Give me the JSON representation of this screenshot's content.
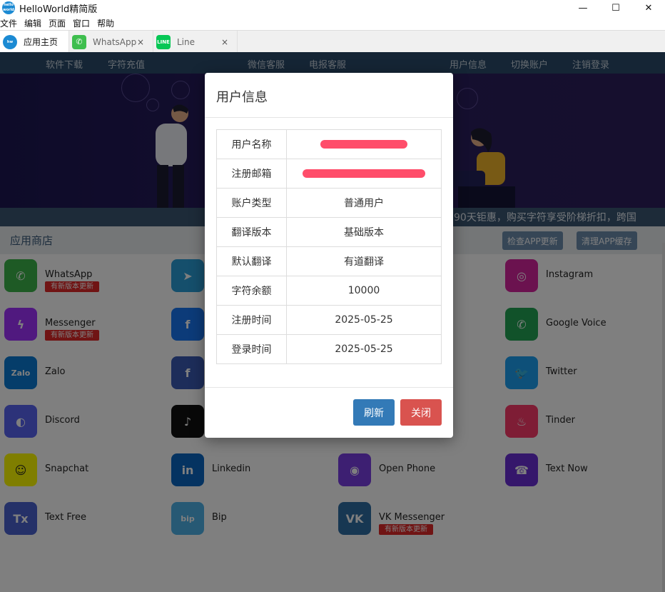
{
  "window": {
    "title": "HelloWorld精简版",
    "logo_text": "hello world",
    "minimize": "—",
    "maximize": "☐",
    "close": "✕"
  },
  "menu": [
    "文件",
    "编辑",
    "页面",
    "窗口",
    "帮助"
  ],
  "tabs": [
    {
      "label": "应用主页",
      "active": true,
      "icon": "helloworld-icon",
      "color": "#1b8ad3"
    },
    {
      "label": "WhatsApp",
      "active": false,
      "icon": "whatsapp-icon",
      "color": "#3ebe4e"
    },
    {
      "label": "Line",
      "active": false,
      "icon": "line-icon",
      "color": "#06c755"
    }
  ],
  "tab_close": "×",
  "nav": [
    "软件下载",
    "字符充值",
    "微信客服",
    "电报客服",
    "用户信息",
    "切换账户",
    "注销登录"
  ],
  "marquee": "90天钜惠，购买字符享受阶梯折扣，跨国",
  "store": {
    "title": "应用商店",
    "check_update": "检查APP更新",
    "clear_cache": "清理APP缓存"
  },
  "apps": [
    {
      "name": "WhatsApp",
      "badge": "有新版本更新",
      "icon": "whatsapp-icon",
      "color": "#3cb44a",
      "glyph": "✆"
    },
    {
      "name": "",
      "badge": "",
      "icon": "telegram-icon",
      "color": "#2a9fd8",
      "glyph": "➤"
    },
    {
      "name": "",
      "badge": "",
      "icon": "hidden-icon",
      "color": "#ffffff",
      "glyph": ""
    },
    {
      "name": "Instagram",
      "badge": "",
      "icon": "instagram-icon",
      "color": "#d6249f",
      "glyph": "◎"
    },
    {
      "name": "Messenger",
      "badge": "有新版本更新",
      "icon": "messenger-icon",
      "color": "#a033ff",
      "glyph": "ϟ"
    },
    {
      "name": "",
      "badge": "",
      "icon": "facebook-icon",
      "color": "#1877f2",
      "glyph": "f"
    },
    {
      "name": "",
      "badge": "",
      "icon": "hidden-icon",
      "color": "#ffffff",
      "glyph": ""
    },
    {
      "name": "Google Voice",
      "badge": "",
      "icon": "google-voice-icon",
      "color": "#23a455",
      "glyph": "✆"
    },
    {
      "name": "Zalo",
      "badge": "",
      "icon": "zalo-icon",
      "color": "#0a7ad4",
      "glyph": "Zalo"
    },
    {
      "name": "",
      "badge": "",
      "icon": "facebook-icon",
      "color": "#3b5bb5",
      "glyph": "f"
    },
    {
      "name": "",
      "badge": "",
      "icon": "hidden-icon",
      "color": "#ffffff",
      "glyph": ""
    },
    {
      "name": "Twitter",
      "badge": "",
      "icon": "twitter-icon",
      "color": "#1da1f2",
      "glyph": "🐦"
    },
    {
      "name": "Discord",
      "badge": "",
      "icon": "discord-icon",
      "color": "#5865f2",
      "glyph": "◐"
    },
    {
      "name": "",
      "badge": "",
      "icon": "tiktok-icon",
      "color": "#111111",
      "glyph": "♪"
    },
    {
      "name": "",
      "badge": "",
      "icon": "hidden-icon",
      "color": "#ffffff",
      "glyph": ""
    },
    {
      "name": "Tinder",
      "badge": "",
      "icon": "tinder-icon",
      "color": "#fd3a6a",
      "glyph": "♨"
    },
    {
      "name": "Snapchat",
      "badge": "",
      "icon": "snapchat-icon",
      "color": "#fffc00",
      "glyph": "☺"
    },
    {
      "name": "Linkedin",
      "badge": "",
      "icon": "linkedin-icon",
      "color": "#0a66c2",
      "glyph": "in"
    },
    {
      "name": "Open Phone",
      "badge": "",
      "icon": "openphone-icon",
      "color": "#7b3fe4",
      "glyph": "◉"
    },
    {
      "name": "Text Now",
      "badge": "",
      "icon": "textnow-icon",
      "color": "#6a2fd6",
      "glyph": "☎"
    },
    {
      "name": "Text Free",
      "badge": "",
      "icon": "textfree-icon",
      "color": "#4a63d0",
      "glyph": "Tx"
    },
    {
      "name": "Bip",
      "badge": "",
      "icon": "bip-icon",
      "color": "#4fb3e8",
      "glyph": "bip"
    },
    {
      "name": "VK Messenger",
      "badge": "有新版本更新",
      "icon": "vk-icon",
      "color": "#2f6ea5",
      "glyph": "VK"
    },
    {
      "name": "",
      "badge": "",
      "icon": "none",
      "color": "#ffffff",
      "glyph": ""
    }
  ],
  "modal": {
    "title": "用户信息",
    "rows": [
      {
        "key": "用户名称",
        "value": "",
        "redacted": true
      },
      {
        "key": "注册邮箱",
        "value": "",
        "redacted": true
      },
      {
        "key": "账户类型",
        "value": "普通用户"
      },
      {
        "key": "翻译版本",
        "value": "基础版本"
      },
      {
        "key": "默认翻译",
        "value": "有道翻译"
      },
      {
        "key": "字符余额",
        "value": "10000"
      },
      {
        "key": "注册时间",
        "value": "2025-05-25"
      },
      {
        "key": "登录时间",
        "value": "2025-05-25"
      }
    ],
    "refresh": "刷新",
    "close": "关闭"
  }
}
